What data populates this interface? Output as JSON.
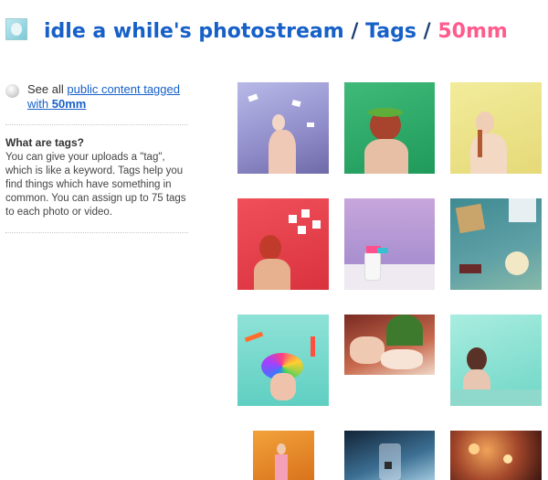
{
  "header": {
    "owner": "idle a while's photostream",
    "separator": "/",
    "section": "Tags",
    "current_tag": "50mm"
  },
  "sidebar": {
    "see_all_prefix": "See all",
    "see_all_link": "public content tagged with",
    "see_all_tag": "50mm",
    "tags_heading": "What are tags?",
    "tags_text": "You can give your uploads a \"tag\", which is like a keyword. Tags help you find things which have something in common. You can assign up to 75 tags to each photo or video."
  },
  "colors": {
    "link": "#1660c8",
    "current_tag": "#ff5c8d"
  },
  "photos": [
    {
      "name": "photo-woman-paper-birds",
      "bg": "linear-gradient(160deg,#b9b9e8,#8f8cc9 60%,#6f6aa8)"
    },
    {
      "name": "photo-woman-flower-crown-green",
      "bg": "linear-gradient(160deg,#3fba79,#1f9a5a)"
    },
    {
      "name": "photo-woman-braid-yellow",
      "bg": "linear-gradient(160deg,#f2ec9b,#e5d978)"
    },
    {
      "name": "photo-woman-red-wall-notes",
      "bg": "linear-gradient(160deg,#f0505a,#d9323e)"
    },
    {
      "name": "photo-curtain-bottle-bow",
      "bg": "linear-gradient(180deg,#c7a6db,#a98fd0 70%,#d9c7e8)"
    },
    {
      "name": "photo-floor-teddy-chair",
      "bg": "linear-gradient(160deg,#3f8a92,#5fa1a6 60%,#88b9a8)"
    },
    {
      "name": "photo-woman-colorful-wig",
      "bg": "linear-gradient(180deg,#8fe2d7,#5fcfc2)"
    },
    {
      "name": "photo-women-christmas-tree",
      "bg": "linear-gradient(160deg,#7a2b22,#c86a4e 60%,#f0d9c9)"
    },
    {
      "name": "photo-woman-teal-wall",
      "bg": "linear-gradient(160deg,#a9ede0,#6fd6c6)"
    },
    {
      "name": "photo-woman-autumn-trees",
      "bg": "linear-gradient(160deg,#f2a23a,#d9731c)"
    },
    {
      "name": "photo-jar-blue-dark",
      "bg": "linear-gradient(160deg,#122438,#3c6f93 60%,#9fc7dd)"
    },
    {
      "name": "photo-bokeh-warm",
      "bg": "radial-gradient(circle at 40% 40%,#f0a35a,#a3472b 50%,#3a1410)"
    }
  ]
}
